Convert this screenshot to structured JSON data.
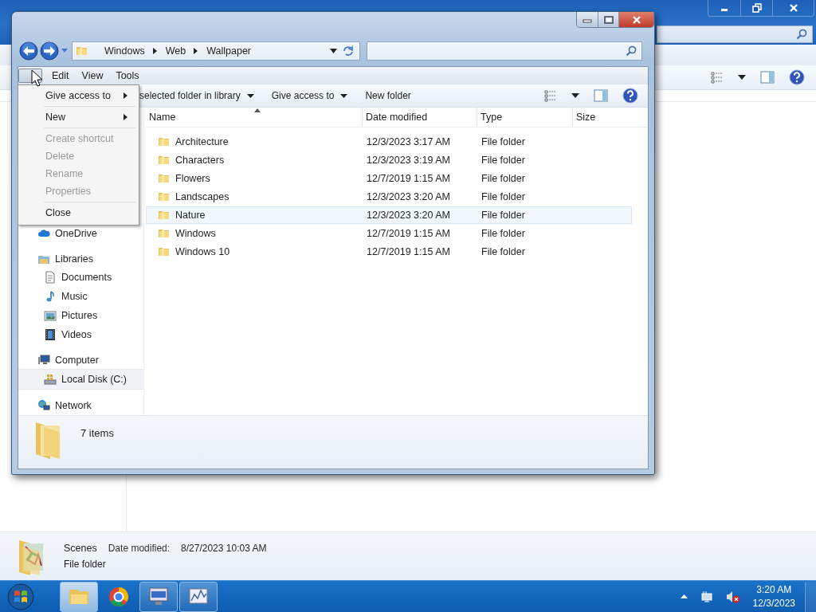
{
  "background_window": {
    "details": {
      "name": "Scenes",
      "date_label": "Date modified:",
      "date": "8/27/2023 10:03 AM",
      "type": "File folder"
    }
  },
  "window": {
    "address": [
      "Windows",
      "Web",
      "Wallpaper"
    ],
    "menu_bar": [
      {
        "label": "Edit"
      },
      {
        "label": "View"
      },
      {
        "label": "Tools"
      }
    ],
    "toolbar": [
      {
        "label": "selected folder in library",
        "dropdown": true
      },
      {
        "label": "Give access to",
        "dropdown": true
      },
      {
        "label": "New folder",
        "dropdown": false
      }
    ],
    "columns": [
      {
        "label": "Name",
        "sorted": true
      },
      {
        "label": "Date modified",
        "sorted": false
      },
      {
        "label": "Type",
        "sorted": false
      },
      {
        "label": "Size",
        "sorted": false
      }
    ],
    "nav": [
      {
        "kind": "cloud",
        "label": "OneDrive",
        "highlighted": false
      },
      {
        "kind": "library",
        "label": "Libraries",
        "highlighted": false,
        "children": [
          {
            "kind": "document",
            "label": "Documents",
            "highlighted": false
          },
          {
            "kind": "music",
            "label": "Music",
            "highlighted": false
          },
          {
            "kind": "picture",
            "label": "Pictures",
            "highlighted": false
          },
          {
            "kind": "video",
            "label": "Videos",
            "highlighted": false
          }
        ]
      },
      {
        "kind": "computer",
        "label": "Computer",
        "highlighted": false,
        "children": [
          {
            "kind": "disk",
            "label": "Local Disk (C:)",
            "highlighted": true
          }
        ]
      },
      {
        "kind": "network",
        "label": "Network",
        "highlighted": false
      }
    ],
    "files": [
      {
        "name": "Architecture",
        "date": "12/3/2023 3:17 AM",
        "type": "File folder",
        "highlighted": false
      },
      {
        "name": "Characters",
        "date": "12/3/2023 3:19 AM",
        "type": "File folder",
        "highlighted": false
      },
      {
        "name": "Flowers",
        "date": "12/7/2019 1:15 AM",
        "type": "File folder",
        "highlighted": false
      },
      {
        "name": "Landscapes",
        "date": "12/3/2023 3:20 AM",
        "type": "File folder",
        "highlighted": false
      },
      {
        "name": "Nature",
        "date": "12/3/2023 3:20 AM",
        "type": "File folder",
        "highlighted": true
      },
      {
        "name": "Windows",
        "date": "12/7/2019 1:15 AM",
        "type": "File folder",
        "highlighted": false
      },
      {
        "name": "Windows 10",
        "date": "12/7/2019 1:15 AM",
        "type": "File folder",
        "highlighted": false
      }
    ],
    "status": "7 items"
  },
  "context_menu": [
    {
      "kind": "item",
      "label": "Give access to",
      "submenu": true,
      "disabled": false
    },
    {
      "kind": "separator"
    },
    {
      "kind": "item",
      "label": "New",
      "submenu": true,
      "disabled": false
    },
    {
      "kind": "separator"
    },
    {
      "kind": "item",
      "label": "Create shortcut",
      "submenu": false,
      "disabled": true
    },
    {
      "kind": "item",
      "label": "Delete",
      "submenu": false,
      "disabled": true
    },
    {
      "kind": "item",
      "label": "Rename",
      "submenu": false,
      "disabled": true
    },
    {
      "kind": "item",
      "label": "Properties",
      "submenu": false,
      "disabled": true
    },
    {
      "kind": "separator"
    },
    {
      "kind": "item",
      "label": "Close",
      "submenu": false,
      "disabled": false
    }
  ],
  "taskbar": {
    "apps": [
      {
        "kind": "explorer",
        "running": true,
        "active": true
      },
      {
        "kind": "chrome",
        "running": false,
        "active": false
      },
      {
        "kind": "monitor",
        "running": true,
        "active": false
      },
      {
        "kind": "chart",
        "running": true,
        "active": false
      }
    ],
    "time": "3:20 AM",
    "date": "12/3/2023"
  }
}
